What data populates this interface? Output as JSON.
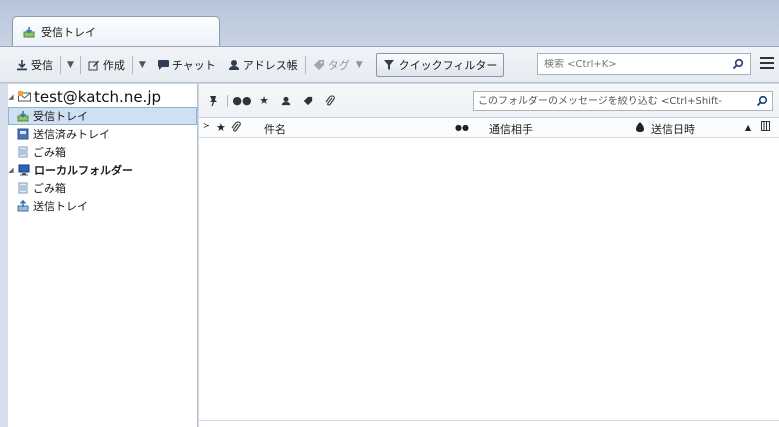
{
  "tab": {
    "label": "受信トレイ"
  },
  "toolbar": {
    "get_mail": "受信",
    "write": "作成",
    "chat": "チャット",
    "address_book": "アドレス帳",
    "tag": "タグ",
    "quick_filter": "クイックフィルター",
    "search_placeholder": "検索 <Ctrl+K>"
  },
  "folders": {
    "account": "test@katch.ne.jp",
    "inbox": "受信トレイ",
    "sent": "送信済みトレイ",
    "trash": "ごみ箱",
    "local": "ローカルフォルダー",
    "local_trash": "ごみ箱",
    "outbox": "送信トレイ"
  },
  "thread": {
    "filter_placeholder": "このフォルダーのメッセージを絞り込む <Ctrl+Shift-",
    "columns": {
      "subject": "件名",
      "correspondent": "通信相手",
      "date": "送信日時"
    }
  },
  "colors": {
    "accent": "#8fb3da",
    "selected": "#cfe0f3",
    "chrome": "#c8d4e4"
  }
}
